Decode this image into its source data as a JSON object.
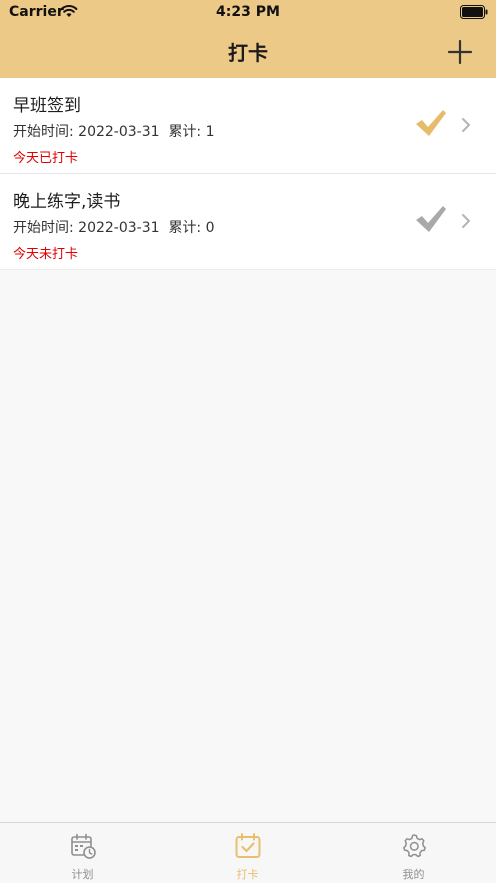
{
  "status_bar": {
    "carrier": "Carrier",
    "time": "4:23 PM"
  },
  "nav": {
    "title": "打卡",
    "add_icon": "plus-icon"
  },
  "checkins": [
    {
      "title": "早班签到",
      "start_label": "开始时间: 2022-03-31",
      "count_label": "累计: 1",
      "status": "今天已打卡",
      "checked": true
    },
    {
      "title": "晚上练字,读书",
      "start_label": "开始时间: 2022-03-31",
      "count_label": "累计: 0",
      "status": "今天未打卡",
      "checked": false
    }
  ],
  "tabs": [
    {
      "label": "计划",
      "icon": "calendar-clock-icon",
      "active": false
    },
    {
      "label": "打卡",
      "icon": "calendar-check-icon",
      "active": true
    },
    {
      "label": "我的",
      "icon": "gear-icon",
      "active": false
    }
  ],
  "colors": {
    "accent": "#ecc986",
    "check_done": "#e6bc6a",
    "check_pending": "#a9a9a9",
    "status_red": "#e00000",
    "tab_active": "#e9bf6e",
    "tab_inactive": "#8f8f8f"
  }
}
